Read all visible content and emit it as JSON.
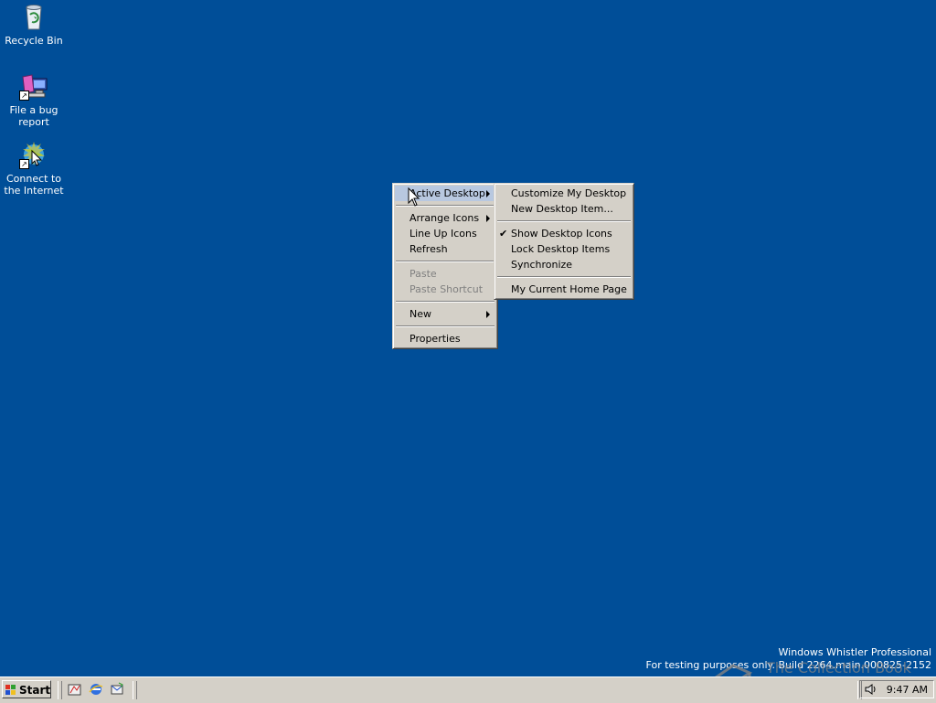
{
  "desktop": {
    "icons": [
      {
        "label": "Recycle Bin",
        "icon": "recycle-bin-icon"
      },
      {
        "label": "File a bug report",
        "icon": "bug-report-icon"
      },
      {
        "label": "Connect to the Internet",
        "icon": "connect-internet-icon"
      }
    ],
    "background_color": "#004e98"
  },
  "context_menu": {
    "items": [
      {
        "label": "Active Desktop",
        "submenu": true
      },
      {
        "label": "Arrange Icons",
        "submenu": true
      },
      {
        "label": "Line Up Icons"
      },
      {
        "label": "Refresh"
      },
      {
        "label": "Paste",
        "disabled": true
      },
      {
        "label": "Paste Shortcut",
        "disabled": true
      },
      {
        "label": "New",
        "submenu": true
      },
      {
        "label": "Properties"
      }
    ]
  },
  "active_desktop_submenu": {
    "items": [
      {
        "label": "Customize My Desktop"
      },
      {
        "label": "New Desktop Item..."
      },
      {
        "label": "Show Desktop Icons",
        "checked": true
      },
      {
        "label": "Lock Desktop Items"
      },
      {
        "label": "Synchronize"
      },
      {
        "label": "My Current Home Page"
      }
    ]
  },
  "watermark": {
    "line1": "Windows Whistler Professional",
    "line2": "For testing purposes only. Build 2264.main.000825-2152",
    "overlay": "The Collection Book"
  },
  "taskbar": {
    "start_label": "Start",
    "clock": "9:47 AM",
    "quick_launch": [
      "show-desktop-icon",
      "internet-explorer-icon",
      "outlook-express-icon"
    ]
  }
}
